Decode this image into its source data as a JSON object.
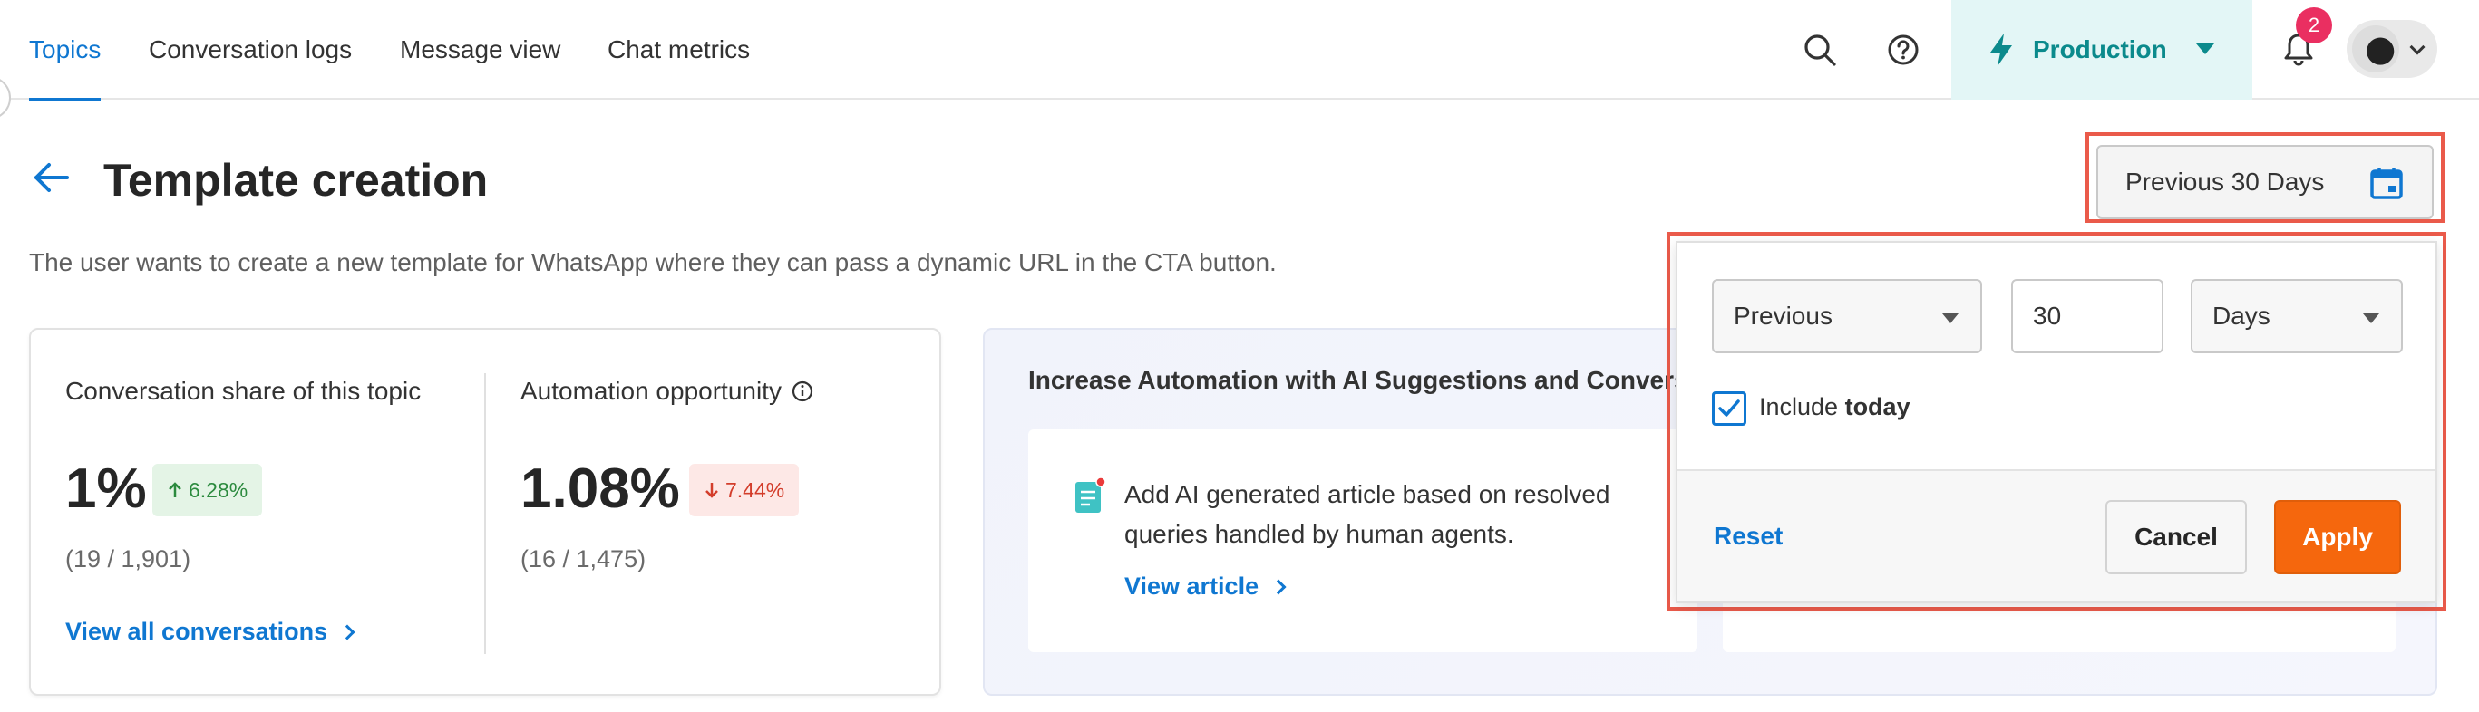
{
  "nav": {
    "tabs": [
      {
        "label": "Topics",
        "active": true
      },
      {
        "label": "Conversation logs",
        "active": false
      },
      {
        "label": "Message view",
        "active": false
      },
      {
        "label": "Chat metrics",
        "active": false
      }
    ],
    "environment": "Production",
    "notification_count": "2",
    "icons": {
      "search": "search-icon",
      "help": "help-icon",
      "env": "lightning-icon",
      "bell": "bell-icon"
    }
  },
  "header": {
    "title": "Template creation",
    "description": "The user wants to create a new template for WhatsApp where they can pass a dynamic URL in the CTA button."
  },
  "metrics": {
    "share": {
      "label": "Conversation share of this topic",
      "value": "1%",
      "change": "6.28%",
      "direction": "up",
      "ratio": "(19 / 1,901)",
      "link": "View all conversations"
    },
    "automation": {
      "label": "Automation opportunity",
      "value": "1.08%",
      "change": "7.44%",
      "direction": "down",
      "ratio": "(16 / 1,475)"
    }
  },
  "suggestions": {
    "title": "Increase Automation with AI Suggestions and Conversa",
    "card": {
      "text": "Add AI generated article based on resolved queries handled by human agents.",
      "link": "View article"
    }
  },
  "date_range": {
    "button_label": "Previous 30 Days",
    "mode": "Previous",
    "amount": "30",
    "unit": "Days",
    "include_prefix": "Include",
    "include_bold": "today",
    "include_checked": true,
    "reset": "Reset",
    "cancel": "Cancel",
    "apply": "Apply"
  },
  "colors": {
    "accent": "#0f77d1",
    "apply": "#f5670d",
    "highlight": "#ea5a4a",
    "env_bg": "#e3f6f6",
    "env_text": "#0b8a8c"
  }
}
